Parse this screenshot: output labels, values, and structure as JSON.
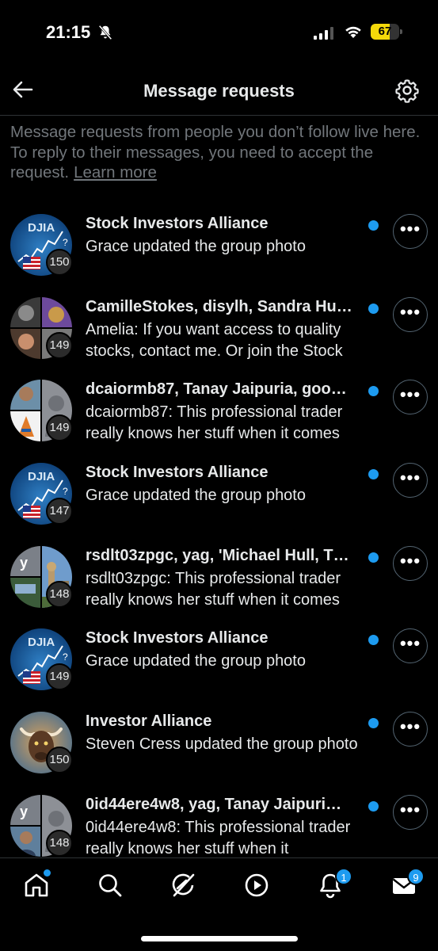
{
  "status_bar": {
    "time": "21:15",
    "battery": "67",
    "battery_level": 0.67
  },
  "header": {
    "title": "Message requests"
  },
  "info": {
    "text": "Message requests from people you don’t follow live here. To reply to their messages, you need to accept the request.",
    "link": "Learn more"
  },
  "requests": [
    {
      "title": "Stock Investors Alliance",
      "preview": "Grace updated the group photo",
      "count": "150",
      "avatar": "djia"
    },
    {
      "title": "CamilleStokes, disylh, Sandra Hu…",
      "preview": "Amelia: If you want access to quality stocks, contact me. Or join the Stock",
      "count": "149",
      "avatar": "quad"
    },
    {
      "title": "dcaiormb87, Tanay Jaipuria, goo…",
      "preview": "dcaiormb87: This professional trader really knows her stuff when it comes",
      "count": "149",
      "avatar": "split-person"
    },
    {
      "title": "Stock Investors Alliance",
      "preview": "Grace updated the group photo",
      "count": "147",
      "avatar": "djia"
    },
    {
      "title": "rsdlt03zpgc, yag, 'Michael Hull, T…",
      "preview": "rsdlt03zpgc: This professional trader really knows her stuff when it comes",
      "count": "148",
      "avatar": "y-city",
      "letter": "y"
    },
    {
      "title": "Stock Investors Alliance",
      "preview": "Grace updated the group photo",
      "count": "149",
      "avatar": "djia"
    },
    {
      "title": "Investor Alliance",
      "preview": "Steven Cress updated the group photo",
      "count": "150",
      "avatar": "bull"
    },
    {
      "title": "0id44ere4w8, yag, Tanay Jaipuri…",
      "preview": "0id44ere4w8: This professional trader really knows her stuff when it",
      "count": "148",
      "avatar": "y-person",
      "letter": "y"
    }
  ],
  "djia_label": "DJIA",
  "tabs": {
    "notifications_badge": "1",
    "messages_badge": "9"
  }
}
